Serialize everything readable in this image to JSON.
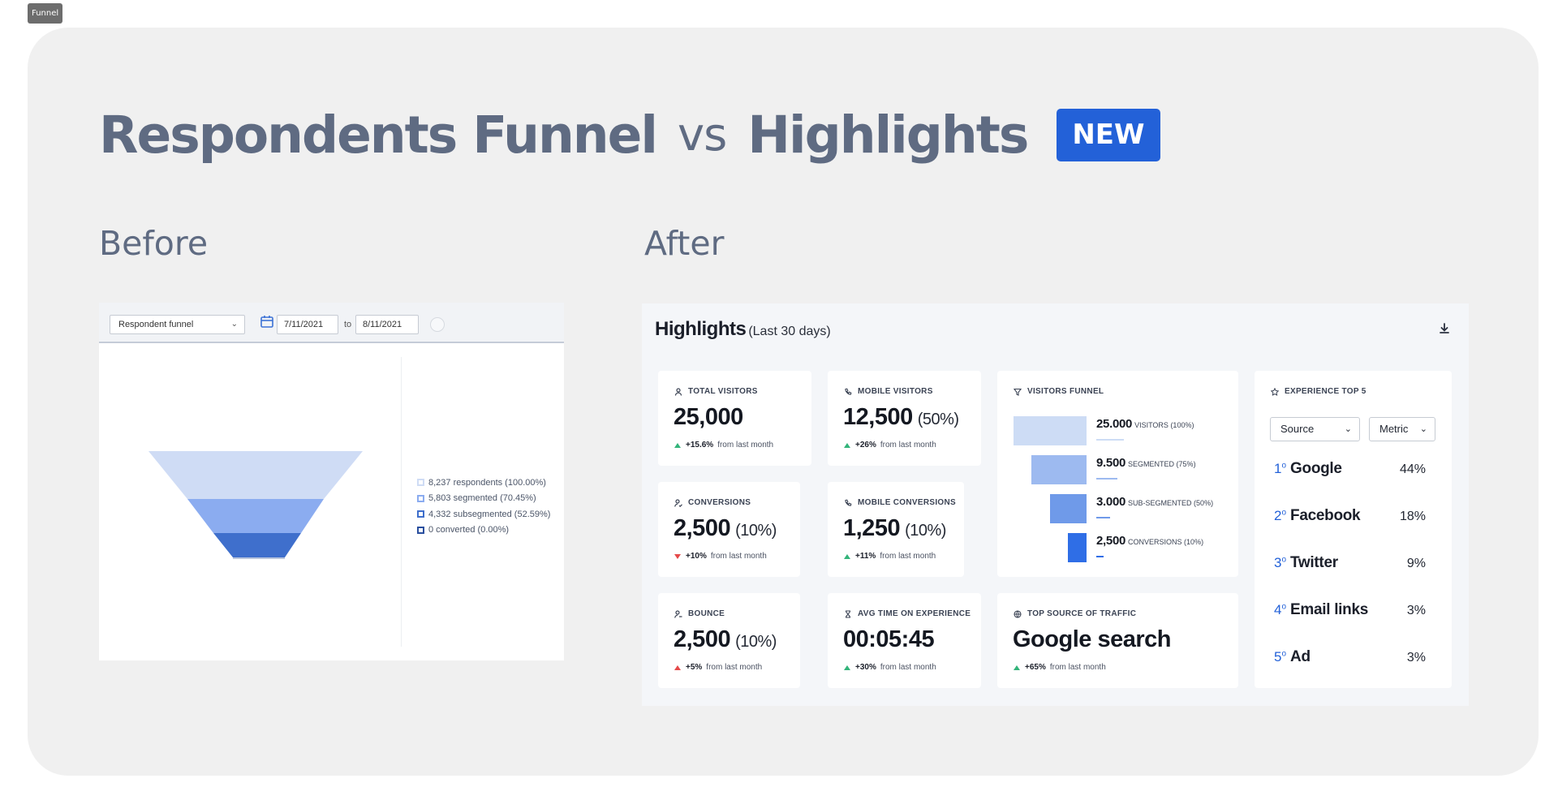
{
  "frame_tag": "Funnel",
  "title": {
    "left": "Respondents Funnel",
    "vs": "vs",
    "right": "Highlights",
    "badge": "NEW"
  },
  "before_label": "Before",
  "after_label": "After",
  "before": {
    "select_value": "Respondent funnel",
    "date_from": "7/11/2021",
    "date_to_label": "to",
    "date_to": "8/11/2021",
    "legend": [
      {
        "label": "8,237 respondents (100.00%)",
        "color": "#cfdcf5"
      },
      {
        "label": "5,803 segmented (70.45%)",
        "color": "#8bacf0"
      },
      {
        "label": "4,332 subsegmented (52.59%)",
        "color": "#3f6fcc"
      },
      {
        "label": "0 converted (0.00%)",
        "color": "#2a4f9e"
      }
    ]
  },
  "after": {
    "header_title": "Highlights",
    "header_subtitle": "(Last 30 days)",
    "cards": {
      "total_visitors": {
        "caption": "TOTAL VISITORS",
        "value": "25,000",
        "pct": "",
        "delta": "+15.6%",
        "delta_text": "from last month",
        "trend": "up"
      },
      "mobile_visitors": {
        "caption": "MOBILE VISITORS",
        "value": "12,500",
        "pct": "(50%)",
        "delta": "+26%",
        "delta_text": "from last month",
        "trend": "up"
      },
      "conversions": {
        "caption": "CONVERSIONS",
        "value": "2,500",
        "pct": "(10%)",
        "delta": "+10%",
        "delta_text": "from last month",
        "trend": "down"
      },
      "mobile_conversions": {
        "caption": "MOBILE CONVERSIONS",
        "value": "1,250",
        "pct": "(10%)",
        "delta": "+11%",
        "delta_text": "from last month",
        "trend": "up"
      },
      "bounce": {
        "caption": "BOUNCE",
        "value": "2,500",
        "pct": "(10%)",
        "delta": "+5%",
        "delta_text": "from last month",
        "trend": "up-red"
      },
      "avg_time": {
        "caption": "AVG TIME ON EXPERIENCE",
        "value": "00:05:45",
        "pct": "",
        "delta": "+30%",
        "delta_text": "from last month",
        "trend": "up"
      },
      "top_source": {
        "caption": "TOP SOURCE OF TRAFFIC",
        "value": "Google search",
        "pct": "",
        "delta": "+65%",
        "delta_text": "from last month",
        "trend": "up"
      }
    },
    "visitors_funnel": {
      "caption": "VISITORS FUNNEL",
      "rows": [
        {
          "value": "25.000",
          "label": "VISITORS (100%)",
          "share": 1.0
        },
        {
          "value": "9.500",
          "label": "SEGMENTED (75%)",
          "share": 0.75
        },
        {
          "value": "3.000",
          "label": "SUB-SEGMENTED (50%)",
          "share": 0.5
        },
        {
          "value": "2,500",
          "label": "CONVERSIONS",
          "label_suffix": "(10%)",
          "share": 0.25
        }
      ]
    },
    "experience_top5": {
      "caption": "EXPERIENCE TOP 5",
      "source_select": "Source",
      "metric_select": "Metric",
      "items": [
        {
          "rank": "1",
          "ord": "o",
          "name": "Google",
          "pct": "44%"
        },
        {
          "rank": "2",
          "ord": "o",
          "name": "Facebook",
          "pct": "18%"
        },
        {
          "rank": "3",
          "ord": "o",
          "name": "Twitter",
          "pct": "9%"
        },
        {
          "rank": "4",
          "ord": "o",
          "name": "Email links",
          "pct": "3%"
        },
        {
          "rank": "5",
          "ord": "o",
          "name": "Ad",
          "pct": "3%"
        }
      ]
    }
  },
  "colors": {
    "accent": "#2361d8",
    "title": "#5f6b82",
    "up": "#33b47a",
    "down": "#e54a4a"
  }
}
